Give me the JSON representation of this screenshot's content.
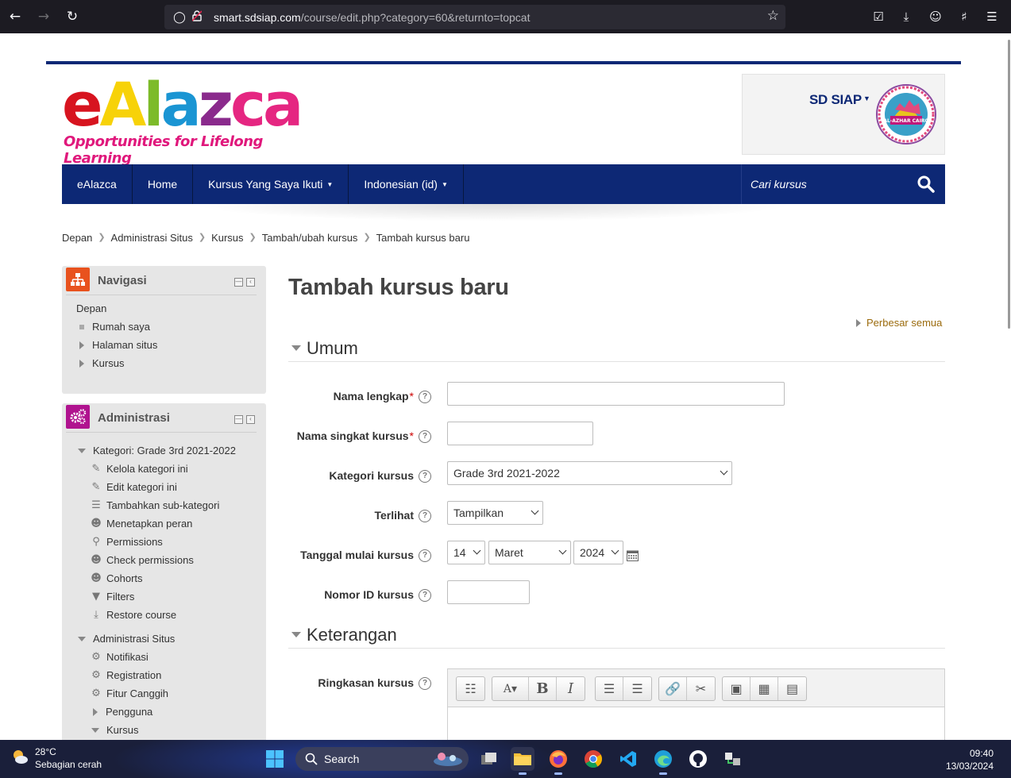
{
  "browser": {
    "url_host": "smart.sdsiap.com",
    "url_path": "/course/edit.php?category=60&returnto=topcat"
  },
  "header": {
    "logo_text": "eAlazca",
    "logo_tagline": "Opportunities for Lifelong Learning",
    "school_name": "SD SIAP",
    "school_logo_text": "AL-AZHAR CAIRO"
  },
  "mainnav": {
    "items": [
      {
        "label": "eAlazca",
        "dropdown": false
      },
      {
        "label": "Home",
        "dropdown": false
      },
      {
        "label": "Kursus Yang Saya Ikuti",
        "dropdown": true
      },
      {
        "label": "Indonesian (id)",
        "dropdown": true
      }
    ],
    "search_placeholder": "Cari kursus"
  },
  "breadcrumb": [
    "Depan",
    "Administrasi Situs",
    "Kursus",
    "Tambah/ubah kursus",
    "Tambah kursus baru"
  ],
  "navigation_block": {
    "title": "Navigasi",
    "items": [
      {
        "label": "Depan",
        "type": "root"
      },
      {
        "label": "Rumah saya",
        "type": "leaf"
      },
      {
        "label": "Halaman situs",
        "type": "collapsed"
      },
      {
        "label": "Kursus",
        "type": "collapsed"
      }
    ]
  },
  "admin_block": {
    "title": "Administrasi",
    "category_title": "Kategori: Grade 3rd 2021-2022",
    "category_items": [
      {
        "label": "Kelola kategori ini",
        "icon": "pencil-icon"
      },
      {
        "label": "Edit kategori ini",
        "icon": "pencil-icon"
      },
      {
        "label": "Tambahkan sub-kategori",
        "icon": "tree-icon"
      },
      {
        "label": "Menetapkan peran",
        "icon": "user-icon"
      },
      {
        "label": "Permissions",
        "icon": "key-icon"
      },
      {
        "label": "Check permissions",
        "icon": "user-check-icon"
      },
      {
        "label": "Cohorts",
        "icon": "users-icon"
      },
      {
        "label": "Filters",
        "icon": "filter-icon"
      },
      {
        "label": "Restore course",
        "icon": "restore-icon"
      }
    ],
    "site_admin_title": "Administrasi Situs",
    "site_admin_items": [
      {
        "label": "Notifikasi",
        "icon": "gear-icon"
      },
      {
        "label": "Registration",
        "icon": "gear-icon"
      },
      {
        "label": "Fitur Canggih",
        "icon": "gear-icon"
      },
      {
        "label": "Pengguna",
        "icon": "collapsed"
      },
      {
        "label": "Kursus",
        "icon": "expanded"
      }
    ]
  },
  "form": {
    "page_title": "Tambah kursus baru",
    "expand_all": "Perbesar semua",
    "section_general": "Umum",
    "section_description": "Keterangan",
    "fields": {
      "fullname_label": "Nama lengkap",
      "shortname_label": "Nama singkat kursus",
      "category_label": "Kategori kursus",
      "category_value": "Grade 3rd 2021-2022",
      "visible_label": "Terlihat",
      "visible_value": "Tampilkan",
      "startdate_label": "Tanggal mulai kursus",
      "start_day": "14",
      "start_month": "Maret",
      "start_year": "2024",
      "idnumber_label": "Nomor ID kursus",
      "summary_label": "Ringkasan kursus"
    }
  },
  "taskbar": {
    "weather_temp": "28°C",
    "weather_desc": "Sebagian cerah",
    "search_label": "Search",
    "time": "09:40",
    "date": "13/03/2024"
  },
  "colors": {
    "brand_navy": "#0d2875",
    "nav_icon_orange": "#e8521e",
    "admin_icon_magenta": "#b0138f",
    "link_gold": "#9b6b0d"
  }
}
